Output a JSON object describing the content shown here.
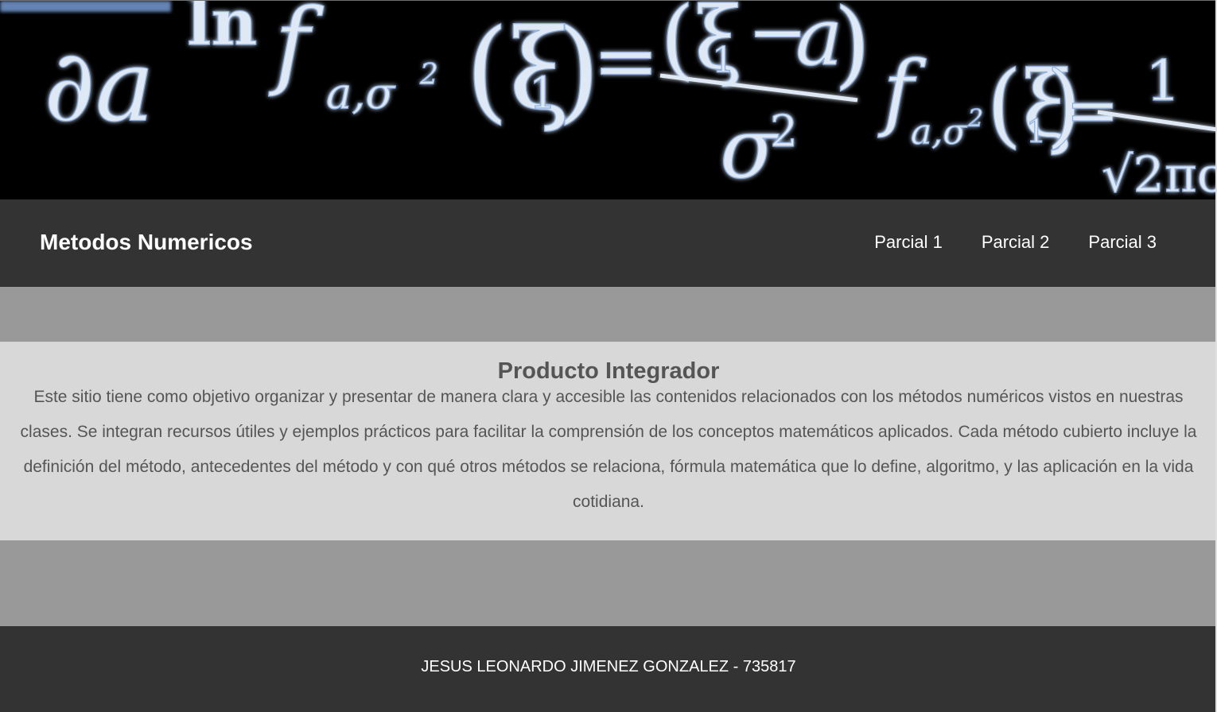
{
  "banner": {
    "image_description_icon": "math-formula-banner",
    "colors": {
      "background": "#000000",
      "glyph": "#dfe8f5",
      "glow": "#6f93c9"
    }
  },
  "navbar": {
    "brand": "Metodos Numericos",
    "links": [
      {
        "label": "Parcial 1"
      },
      {
        "label": "Parcial 2"
      },
      {
        "label": "Parcial 3"
      }
    ]
  },
  "intro": {
    "title": "Producto Integrador",
    "text": "Este sitio tiene como objetivo organizar y presentar de manera clara y accesible las contenidos relacionados con los métodos numéricos vistos en nuestras clases. Se integran recursos útiles y ejemplos prácticos para facilitar la comprensión de los conceptos matemáticos aplicados. Cada método cubierto incluye la definición del método, antecedentes del método y con qué otros métodos se relaciona, fórmula matemática que lo define, algoritmo, y las aplicación en la vida cotidiana."
  },
  "footer": {
    "text": "JESUS LEONARDO JIMENEZ GONZALEZ - 735817"
  },
  "colors": {
    "navbar_bg": "#333333",
    "band_bg": "#999999",
    "intro_bg": "#d8d8d8",
    "intro_text": "#555555",
    "footer_bg": "#333333"
  }
}
